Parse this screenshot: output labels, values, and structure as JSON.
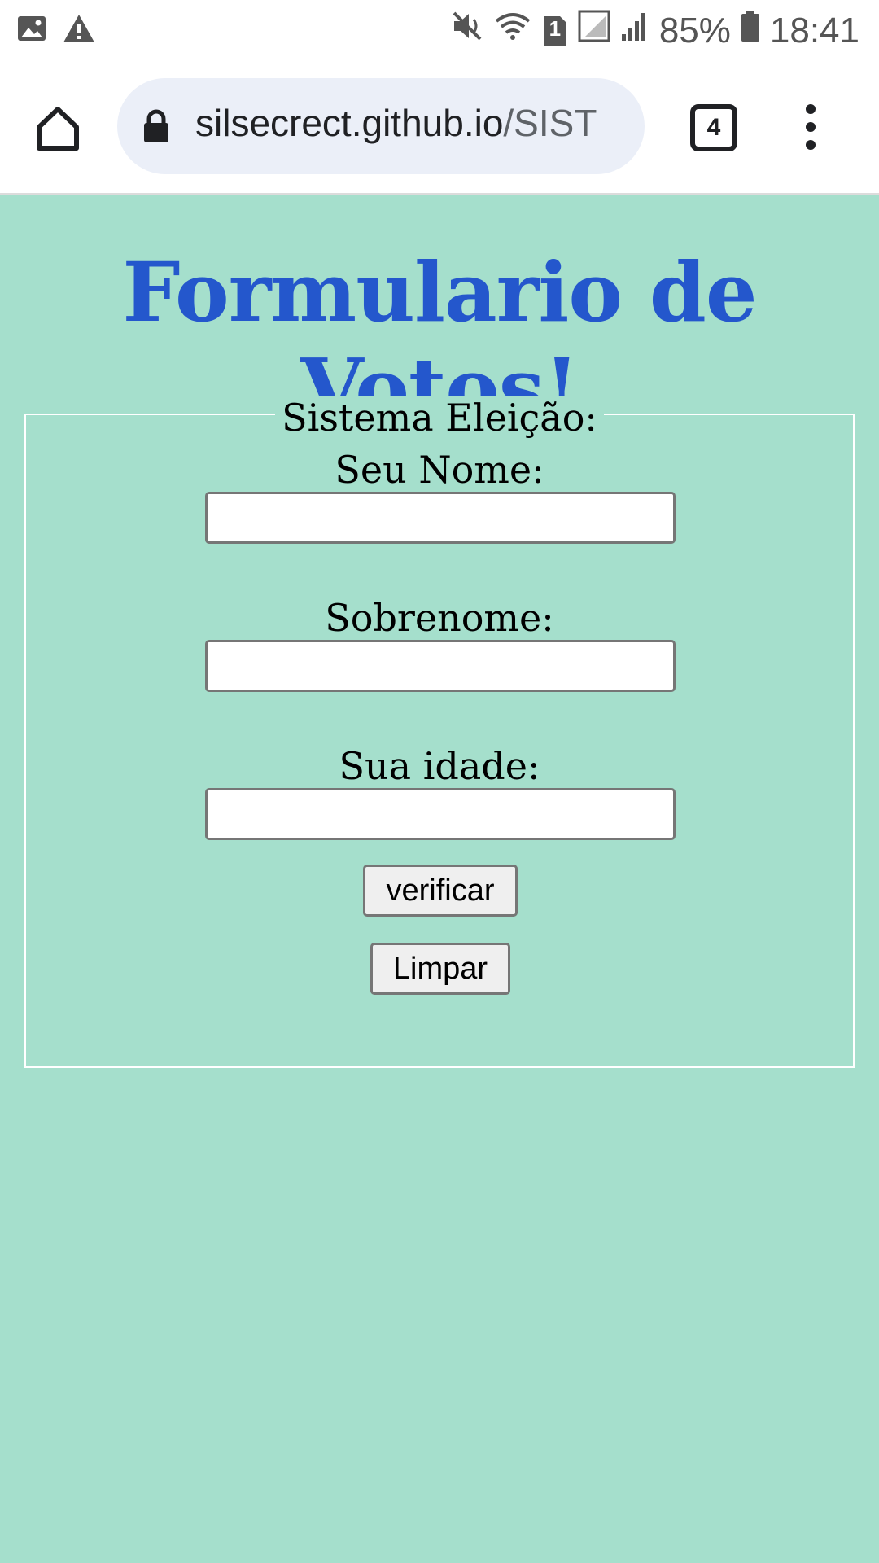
{
  "status_bar": {
    "battery": "85%",
    "time": "18:41",
    "sim_badge": "1",
    "icons": [
      "gallery-icon",
      "warning-icon",
      "mute-icon",
      "wifi-icon",
      "sim-1-icon",
      "signal-icon",
      "signal-icon",
      "battery-icon"
    ]
  },
  "browser": {
    "url_domain": "silsecrect.github.io",
    "url_path": "/SIST",
    "tab_count": "4",
    "icons": [
      "home-icon",
      "lock-icon",
      "tabs-icon",
      "more-vert-icon"
    ]
  },
  "page": {
    "title": "Formulario de Votos!",
    "background": "#a5dfcc",
    "title_color": "#2457cc",
    "form": {
      "legend": "Sistema Eleição:",
      "name_label": "Seu Nome:",
      "name_value": "",
      "surname_label": "Sobrenome:",
      "surname_value": "",
      "age_label": "Sua idade:",
      "age_value": "",
      "verify_button": "verificar",
      "clear_button": "Limpar"
    }
  }
}
